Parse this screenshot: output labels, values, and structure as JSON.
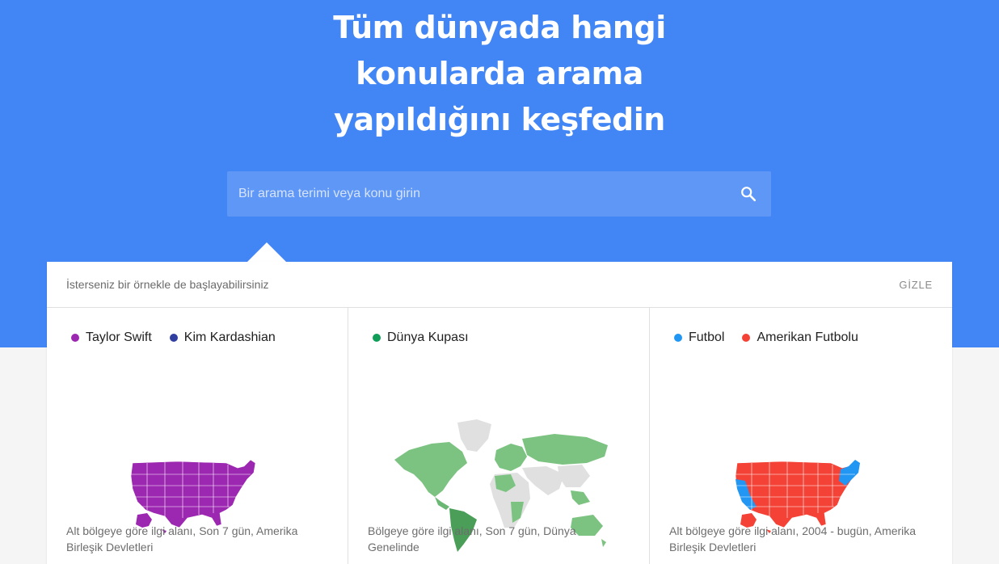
{
  "hero": {
    "title_lines": [
      "Tüm dünyada hangi",
      "konularda arama",
      "yapıldığını keşfedin"
    ]
  },
  "search": {
    "placeholder": "Bir arama terimi veya konu girin",
    "icon": "search-icon"
  },
  "examples": {
    "intro": "İsterseniz bir örnekle de başlayabilirsiniz",
    "hide_label": "GİZLE",
    "cards": [
      {
        "legend": [
          {
            "label": "Taylor Swift",
            "color": "#9c27b0"
          },
          {
            "label": "Kim Kardashian",
            "color": "#303f9f"
          }
        ],
        "map": "usa-map",
        "caption": "Alt bölgeye göre ilgi alanı, Son 7 gün, Amerika Birleşik Devletleri"
      },
      {
        "legend": [
          {
            "label": "Dünya Kupası",
            "color": "#0f9d58"
          }
        ],
        "map": "world-map",
        "caption": "Bölgeye göre ilgi alanı, Son 7 gün, Dünya Genelinde"
      },
      {
        "legend": [
          {
            "label": "Futbol",
            "color": "#2196f3"
          },
          {
            "label": "Amerikan Futbolu",
            "color": "#f44336"
          }
        ],
        "map": "usa-map",
        "caption": "Alt bölgeye göre ilgi alanı, 2004 - bugün, Amerika Birleşik Devletleri"
      }
    ]
  }
}
